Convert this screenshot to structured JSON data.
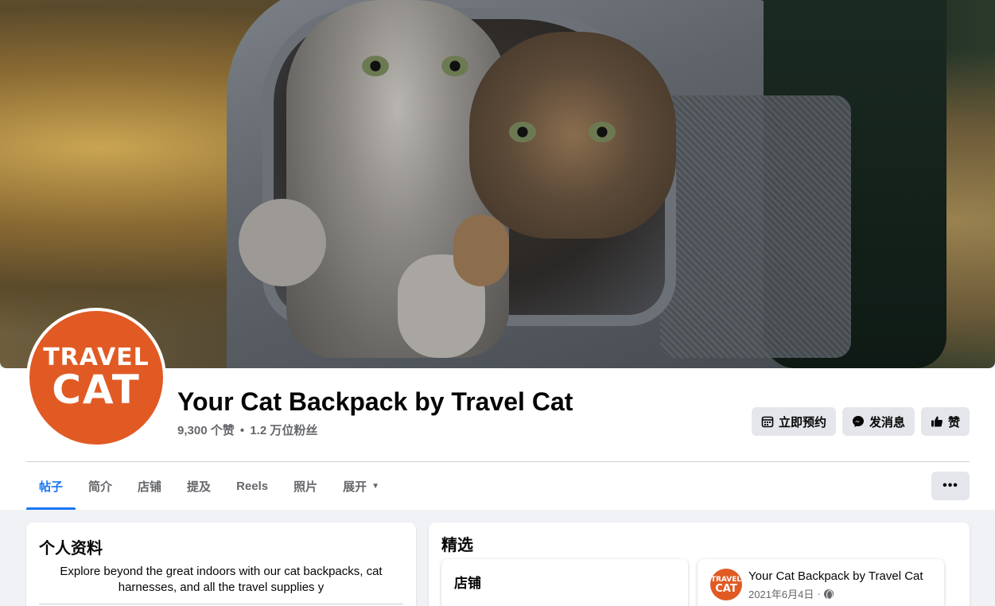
{
  "header": {
    "page_name": "Your Cat Backpack by Travel Cat",
    "likes": "9,300 个赞",
    "separator": "•",
    "followers": "1.2 万位粉丝",
    "avatar_logo_top": "TRAVEL",
    "avatar_logo_bottom": "CAT"
  },
  "actions": {
    "book_now": "立即预约",
    "message": "发消息",
    "like": "赞"
  },
  "tabs": [
    {
      "label": "帖子",
      "active": true
    },
    {
      "label": "简介"
    },
    {
      "label": "店铺"
    },
    {
      "label": "提及"
    },
    {
      "label": "Reels"
    },
    {
      "label": "照片"
    },
    {
      "label": "展开"
    }
  ],
  "more_button": "•••",
  "profile_card": {
    "title": "个人资料",
    "bio": "Explore beyond the great indoors with our cat backpacks, cat harnesses, and all the travel supplies y"
  },
  "featured": {
    "title": "精选",
    "shop_label": "店铺",
    "post": {
      "author": "Your Cat Backpack by Travel Cat",
      "date": "2021年6月4日",
      "dot": "·"
    }
  },
  "colors": {
    "accent": "#1877f2",
    "brand_orange": "#e15a24",
    "button_bg": "#e4e6eb"
  }
}
